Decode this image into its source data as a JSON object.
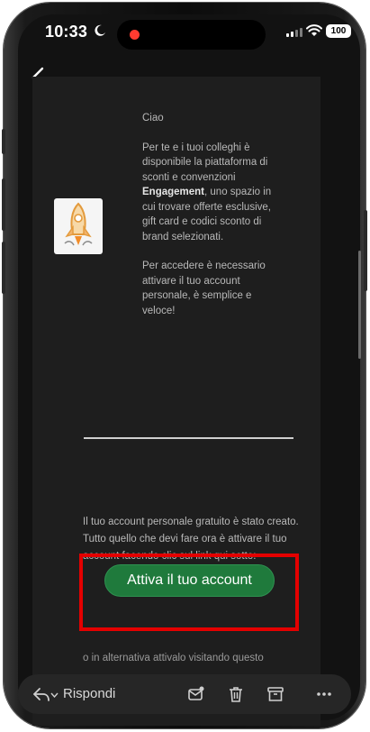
{
  "status": {
    "time": "10:33",
    "battery": "100"
  },
  "email": {
    "greeting": "Ciao",
    "para1_before": "Per te e i tuoi colleghi è disponibile la piattaforma di sconti e convenzioni ",
    "brand": "Engagement",
    "para1_after": ", uno spazio in cui trovare offerte esclusive, gift card e codici sconto di brand selezionati.",
    "para2": "Per accedere è necessario attivare il tuo account personale, è semplice e veloce!",
    "body": "Il tuo account personale gratuito è stato creato. Tutto quello che devi fare ora è attivare il tuo account facendo clic sul link qui sotto:",
    "cta_label": "Attiva il tuo account",
    "alt_text": "o in alternativa attivalo visitando questo"
  },
  "toolbar": {
    "reply_label": "Rispondi"
  },
  "colors": {
    "cta": "#1f7a3c",
    "highlight": "#e40000",
    "background": "#121212"
  },
  "icons": [
    "moon-icon",
    "signal-icon",
    "wifi-icon",
    "back-chevron-icon",
    "rocket-icon",
    "reply-icon",
    "chevron-down-icon",
    "mail-badge-icon",
    "trash-icon",
    "archive-icon",
    "more-icon"
  ]
}
